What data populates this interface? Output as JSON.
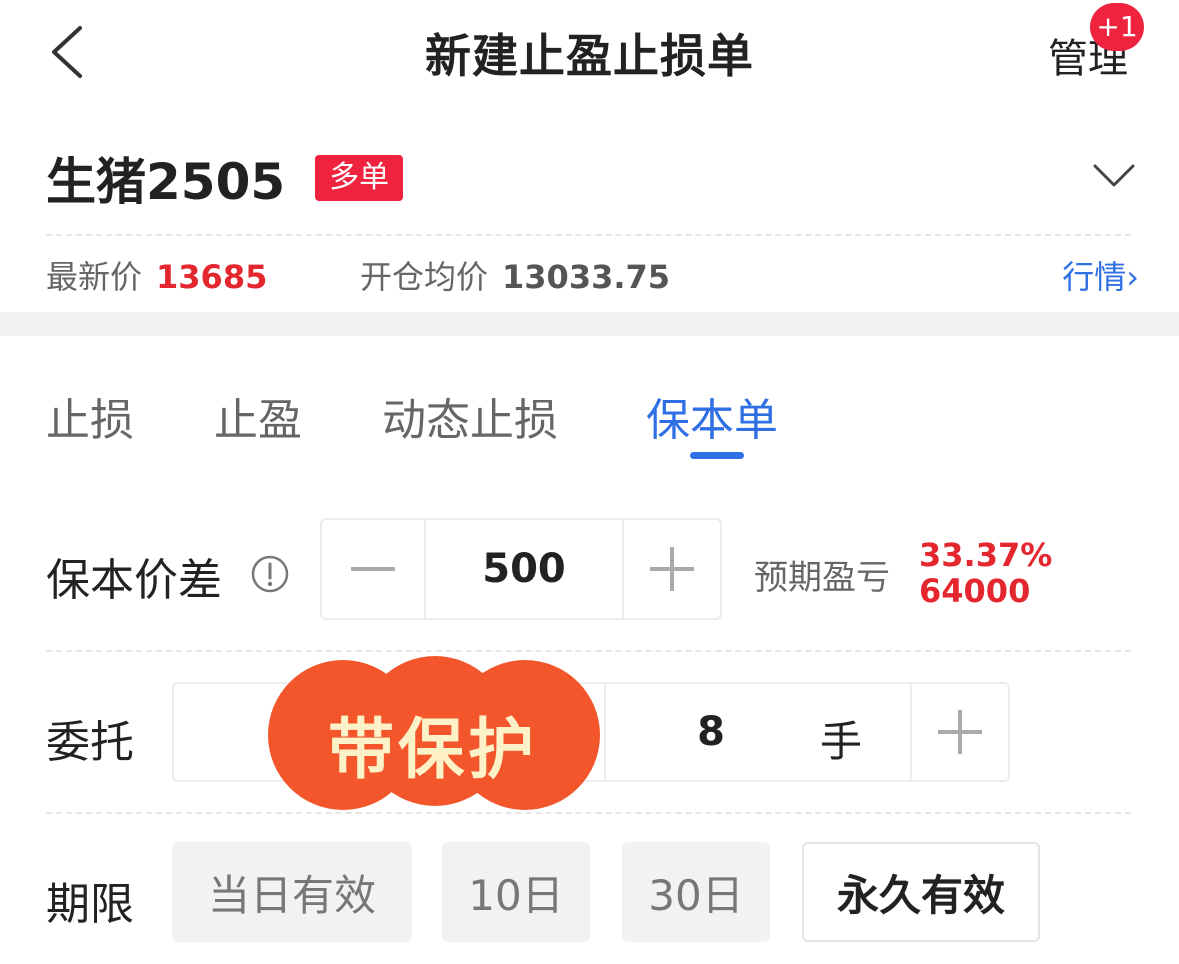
{
  "header": {
    "title": "新建止盈止损单",
    "manage_label": "管理",
    "badge": "+1"
  },
  "contract": {
    "name": "生猪2505",
    "side_tag": "多单"
  },
  "prices": {
    "last_label": "最新价",
    "last_value": "13685",
    "avg_label": "开仓均价",
    "avg_value": "13033.75",
    "market_link": "行情›"
  },
  "tabs": [
    {
      "label": "止损"
    },
    {
      "label": "止盈"
    },
    {
      "label": "动态止损"
    },
    {
      "label": "保本单",
      "active": true
    }
  ],
  "breakeven": {
    "label": "保本价差",
    "value": "500",
    "expect_label": "预期盈亏",
    "expect_pct": "33.37%",
    "expect_value": "64000"
  },
  "order": {
    "label": "委托",
    "lots": "8",
    "unit": "手"
  },
  "promo": {
    "text": "带保护"
  },
  "expiry": {
    "label": "期限",
    "options": [
      "当日有效",
      "10日",
      "30日",
      "永久有效"
    ],
    "selected": "永久有效"
  },
  "colors": {
    "accent_blue": "#2f6fe4",
    "red": "#e4262f",
    "badge_red": "#f0233f",
    "promo_orange": "#f2562a"
  }
}
